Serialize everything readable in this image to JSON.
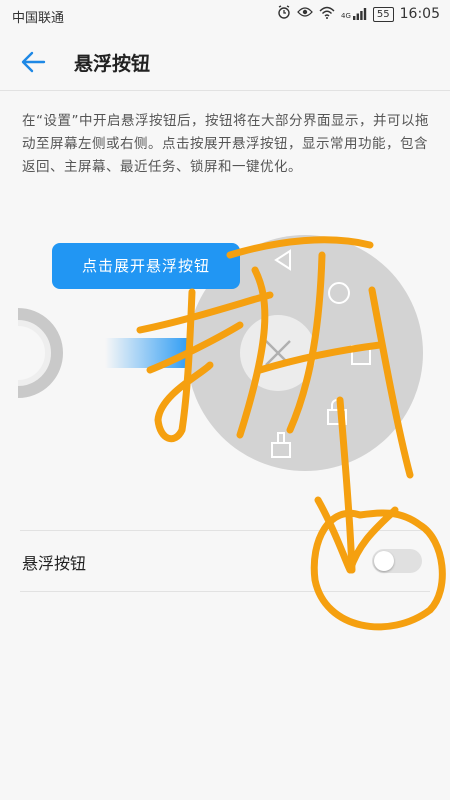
{
  "status_bar": {
    "carrier": "中国联通",
    "network": "4G",
    "battery": "55",
    "time": "16:05"
  },
  "app_bar": {
    "title": "悬浮按钮"
  },
  "description": "在“设置”中开启悬浮按钮后，按钮将在大部分界面显示，并可以拖动至屏幕左侧或右侧。点击按展开悬浮按钮，显示常用功能，包含返回、主屏幕、最近任务、锁屏和一键优化。",
  "illustration": {
    "hint_label": "点击展开悬浮按钮",
    "menu_icons": [
      "back-triangle-icon",
      "home-circle-icon",
      "close-x-icon",
      "recent-square-icon",
      "lock-icon",
      "broom-icon"
    ]
  },
  "settings_row": {
    "label": "悬浮按钮",
    "toggle_on": false
  },
  "colors": {
    "accent": "#2196f3",
    "scribble": "#f5a010"
  }
}
